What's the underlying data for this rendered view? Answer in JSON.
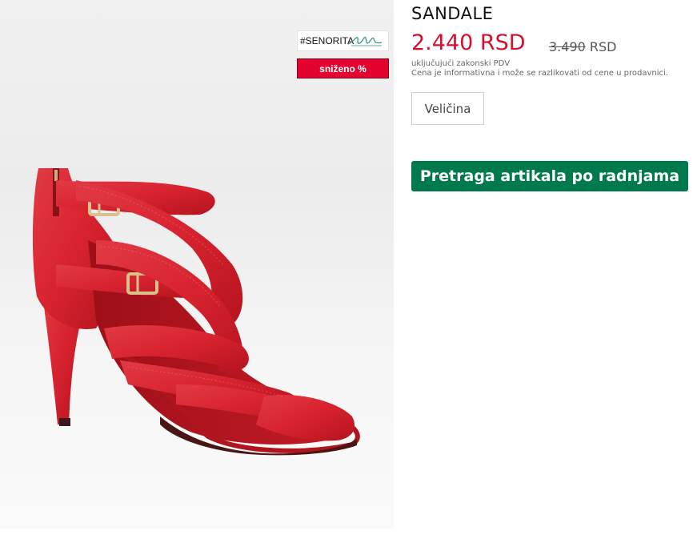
{
  "product": {
    "title": "SANDALE",
    "price": "2.440 RSD",
    "old_price_number": "3.490",
    "old_price_currency": " RSD",
    "vat_note": "uključujući zakonski PDV",
    "info_note": "Cena je informativna i može se razlikovati od cene u prodavnici."
  },
  "badges": {
    "brand_label": "#SENORITA",
    "sale_label": "sniženo %"
  },
  "actions": {
    "size_label": "Veličina",
    "store_search_label": "Pretraga artikala po radnjama"
  },
  "colors": {
    "price_red": "#d50f2e",
    "sale_red": "#e4032e",
    "store_green": "#007a4d",
    "shoe_red": "#d8232f"
  }
}
